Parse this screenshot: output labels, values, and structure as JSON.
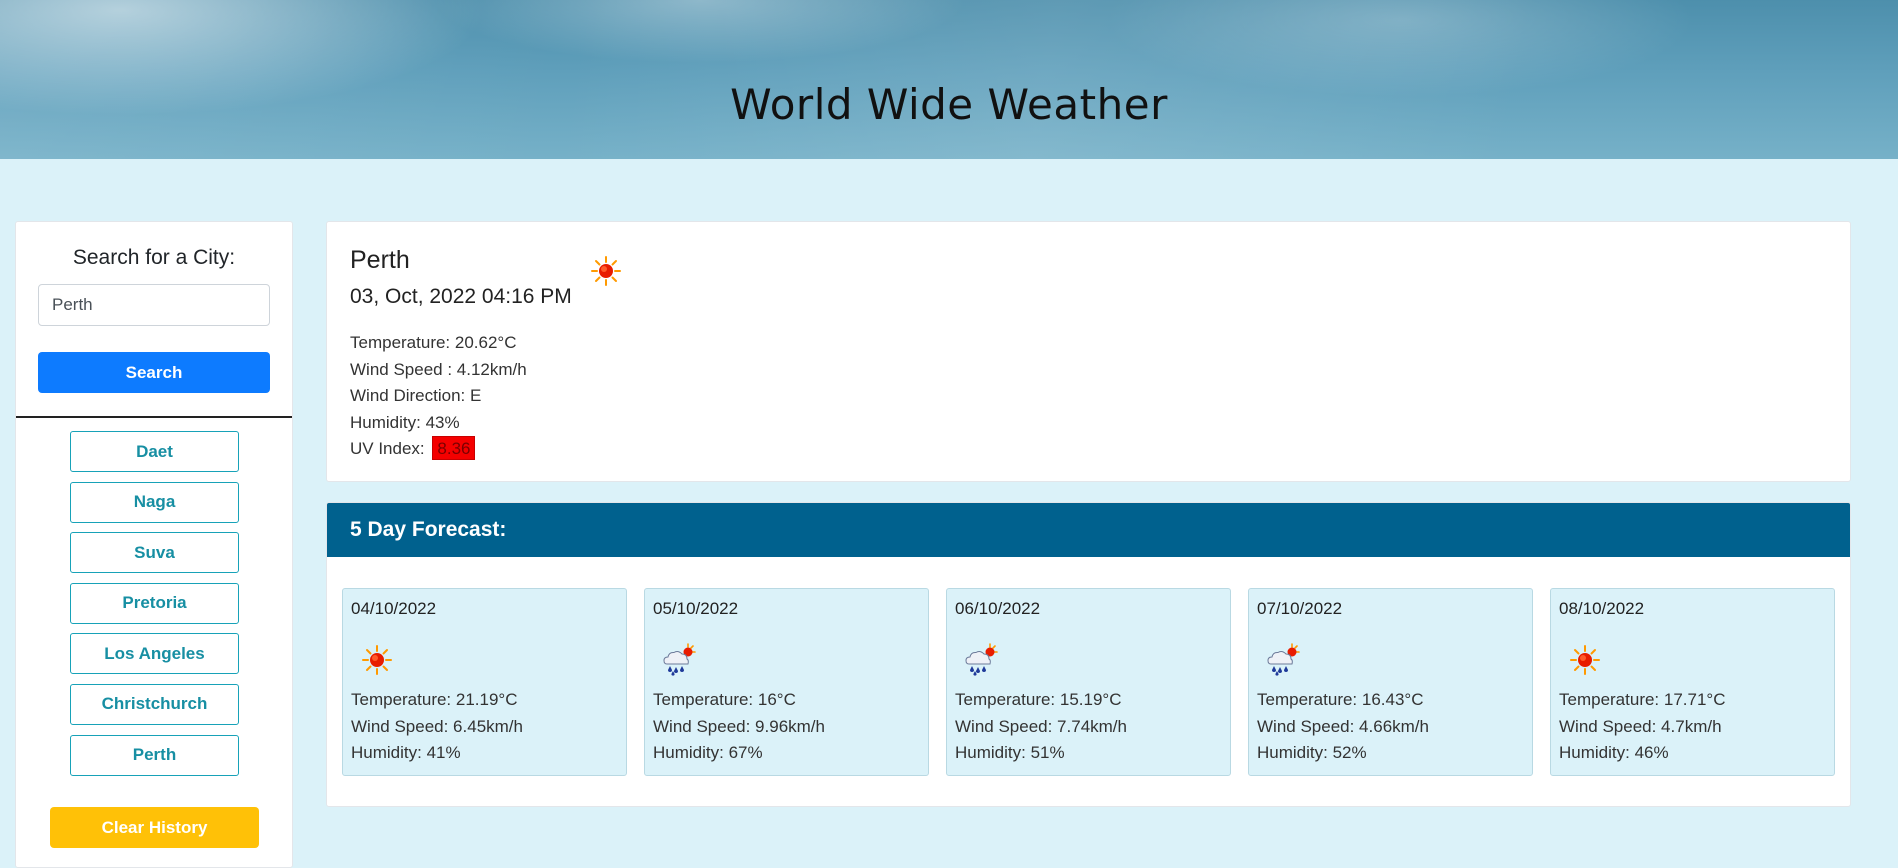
{
  "header": {
    "title": "World Wide Weather"
  },
  "search": {
    "heading": "Search for a City:",
    "value": "Perth",
    "button_label": "Search"
  },
  "history": {
    "items": [
      "Daet",
      "Naga",
      "Suva",
      "Pretoria",
      "Los Angeles",
      "Christchurch",
      "Perth"
    ],
    "clear_label": "Clear History"
  },
  "current": {
    "city": "Perth",
    "datetime": "03, Oct, 2022 04:16 PM",
    "icon": "sun-icon",
    "temperature": "Temperature: 20.62°C",
    "wind_speed": "Wind Speed : 4.12km/h",
    "wind_direction": "Wind Direction: E",
    "humidity": "Humidity: 43%",
    "uv_label": "UV Index:",
    "uv_value": "8.36",
    "uv_color": "#f40000"
  },
  "forecast": {
    "title": "5 Day Forecast:",
    "days": [
      {
        "date": "04/10/2022",
        "icon": "sun-icon",
        "temperature": "Temperature: 21.19°C",
        "wind": "Wind Speed: 6.45km/h",
        "humidity": "Humidity: 41%"
      },
      {
        "date": "05/10/2022",
        "icon": "rain-cloud-sun-icon",
        "temperature": "Temperature: 16°C",
        "wind": "Wind Speed: 9.96km/h",
        "humidity": "Humidity: 67%"
      },
      {
        "date": "06/10/2022",
        "icon": "rain-cloud-sun-icon",
        "temperature": "Temperature: 15.19°C",
        "wind": "Wind Speed: 7.74km/h",
        "humidity": "Humidity: 51%"
      },
      {
        "date": "07/10/2022",
        "icon": "rain-cloud-sun-icon",
        "temperature": "Temperature: 16.43°C",
        "wind": "Wind Speed: 4.66km/h",
        "humidity": "Humidity: 52%"
      },
      {
        "date": "08/10/2022",
        "icon": "sun-icon",
        "temperature": "Temperature: 17.71°C",
        "wind": "Wind Speed: 4.7km/h",
        "humidity": "Humidity: 46%"
      }
    ]
  },
  "colors": {
    "page_background": "#dbf2f9",
    "search_button": "#0d7bff",
    "history_border": "#17a2b8",
    "clear_button": "#ffc107",
    "forecast_header": "#00618e"
  }
}
